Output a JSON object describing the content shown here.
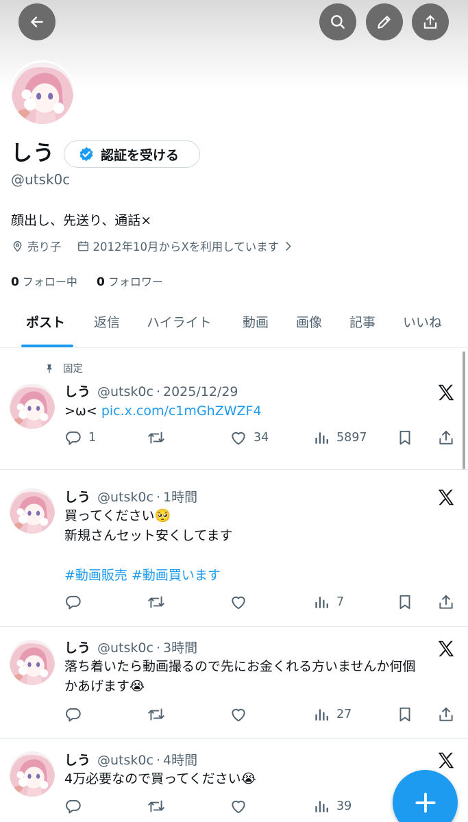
{
  "profile": {
    "display_name": "しう",
    "verify_label": "認証を受ける",
    "handle": "@utsk0c",
    "bio": "顔出し、先送り、通話×",
    "location": "売り子",
    "joined": "2012年10月からXを利用しています",
    "following_count": "0",
    "following_label": "フォロー中",
    "followers_count": "0",
    "followers_label": "フォロワー"
  },
  "tabs": [
    {
      "label": "ポスト",
      "active": true
    },
    {
      "label": "返信"
    },
    {
      "label": "ハイライト"
    },
    {
      "label": "動画"
    },
    {
      "label": "画像"
    },
    {
      "label": "記事"
    },
    {
      "label": "いいね"
    }
  ],
  "pinned_label": "固定",
  "posts": [
    {
      "name": "しう",
      "handle": "@utsk0c",
      "sep": "·",
      "time": "2025/12/29",
      "text": ">ω<",
      "link": "pic.x.com/c1mGhZWZF4",
      "replies": "1",
      "reposts": "",
      "likes": "34",
      "views": "5897"
    },
    {
      "name": "しう",
      "handle": "@utsk0c",
      "sep": "·",
      "time": "1時間",
      "line1": "買ってください🥺",
      "line2": "新規さんセット安くしてます",
      "hashtags": "#動画販売 #動画買います",
      "replies": "",
      "reposts": "",
      "likes": "",
      "views": "7"
    },
    {
      "name": "しう",
      "handle": "@utsk0c",
      "sep": "·",
      "time": "3時間",
      "line1": "落ち着いたら動画撮るので先にお金くれる方いませんか何個",
      "line2": "かあげます😭",
      "replies": "",
      "reposts": "",
      "likes": "",
      "views": "27"
    },
    {
      "name": "しう",
      "handle": "@utsk0c",
      "sep": "·",
      "time": "4時間",
      "line1": "4万必要なので買ってください😭",
      "replies": "",
      "reposts": "",
      "likes": "",
      "views": "39"
    }
  ],
  "colors": {
    "accent": "#1d9bf0",
    "text": "#0f1419",
    "muted": "#536471"
  }
}
